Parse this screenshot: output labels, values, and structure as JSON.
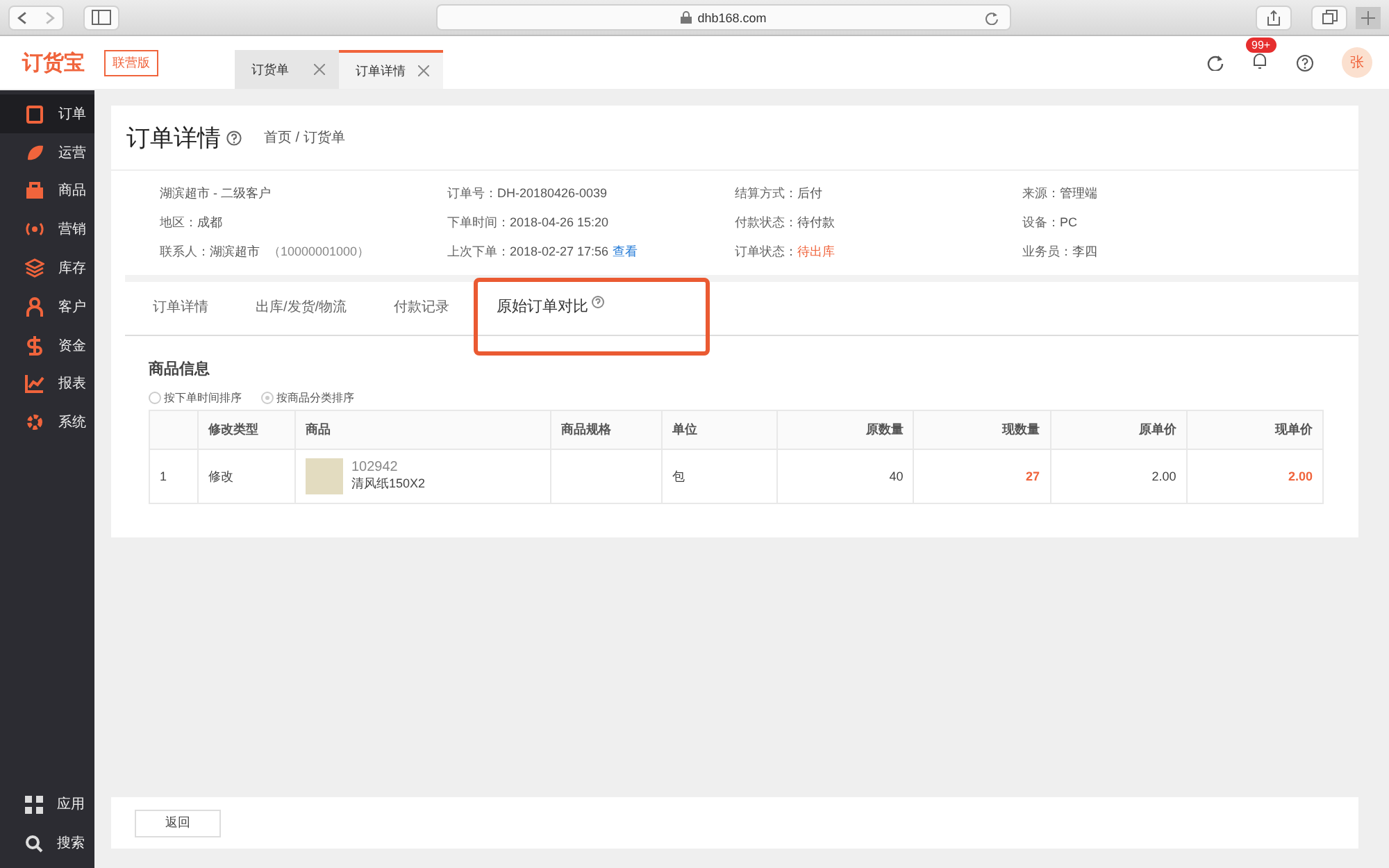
{
  "browser": {
    "url": "dhb168.com"
  },
  "header": {
    "logo": "订货宝",
    "edition": "联营版",
    "tabs": [
      {
        "label": "订货单",
        "selected": false
      },
      {
        "label": "订单详情",
        "selected": true
      }
    ],
    "badge": "99+",
    "avatar": "张"
  },
  "sidebar": {
    "items": [
      {
        "label": "订单",
        "selected": true
      },
      {
        "label": "运营",
        "selected": false
      },
      {
        "label": "商品",
        "selected": false
      },
      {
        "label": "营销",
        "selected": false
      },
      {
        "label": "库存",
        "selected": false
      },
      {
        "label": "客户",
        "selected": false
      },
      {
        "label": "资金",
        "selected": false
      },
      {
        "label": "报表",
        "selected": false
      },
      {
        "label": "系统",
        "selected": false
      }
    ],
    "bottom_items": [
      "应用",
      "搜索"
    ]
  },
  "page": {
    "title": "订单详情",
    "breadcrumb": "首页 / 订货单"
  },
  "info": [
    [
      {
        "value": "湖滨超市 - 二级客户",
        "kind": "plain"
      },
      {
        "label": "地区：",
        "value": "成都",
        "kind": "plain"
      },
      {
        "label": "联系人：",
        "value": "湖滨超市",
        "extra": "（10000001000）",
        "kind": "plain"
      }
    ],
    [
      {
        "label": "订单号：",
        "value": "DH-20180426-0039",
        "kind": "plain"
      },
      {
        "label": "下单时间：",
        "value": "2018-04-26 15:20",
        "kind": "plain"
      },
      {
        "label": "上次下单：",
        "value": "2018-02-27 17:56",
        "link": "查看",
        "kind": "plain"
      }
    ],
    [
      {
        "label": "结算方式：",
        "value": "后付",
        "kind": "plain"
      },
      {
        "label": "付款状态：",
        "value": "待付款",
        "kind": "plain"
      },
      {
        "label": "订单状态：",
        "value": "待出库",
        "kind": "warn"
      }
    ],
    [
      {
        "label": "来源：",
        "value": "管理端",
        "kind": "plain"
      },
      {
        "label": "设备：",
        "value": "PC",
        "kind": "plain"
      },
      {
        "label": "业务员：",
        "value": "李四",
        "kind": "plain"
      }
    ]
  ],
  "tabs": [
    {
      "label": "订单详情",
      "selected": false,
      "highlighted": false
    },
    {
      "label": "出库/发货/物流",
      "selected": false,
      "highlighted": false
    },
    {
      "label": "付款记录",
      "selected": false,
      "highlighted": false
    },
    {
      "label": "原始订单对比",
      "selected": true,
      "highlighted": true
    }
  ],
  "section": {
    "title": "商品信息",
    "sort_options": [
      {
        "label": "按下单时间排序",
        "selected": false
      },
      {
        "label": "按商品分类排序",
        "selected": true
      }
    ]
  },
  "table": {
    "columns": [
      "修改类型",
      "商品",
      "商品规格",
      "单位",
      "原数量",
      "现数量",
      "原单价",
      "现单价"
    ],
    "rows": [
      {
        "index": "1",
        "change_type": "修改",
        "code": "102942",
        "name": "清风纸150X2",
        "unit": "包",
        "orig_qty": "40",
        "new_qty": "27",
        "orig_price": "2.00",
        "new_price": "2.00",
        "changed": true
      }
    ]
  },
  "footer": {
    "back_button": "返回"
  }
}
